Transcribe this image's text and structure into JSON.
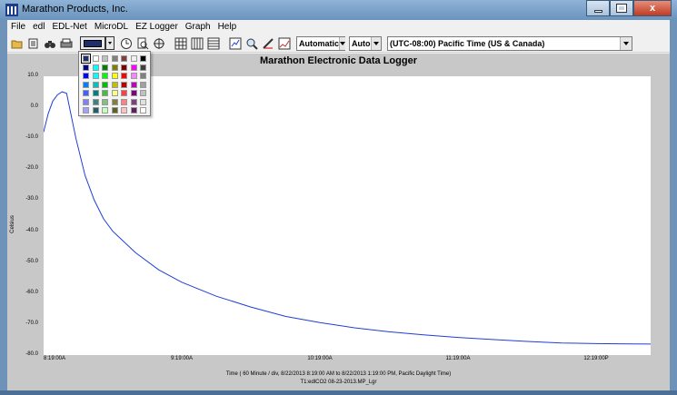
{
  "window": {
    "title": "Marathon Products, Inc.",
    "caption_buttons": {
      "minimize": "minimize",
      "maximize": "maximize",
      "close": "x"
    }
  },
  "menu": [
    "File",
    "edl",
    "EDL-Net",
    "MicroDL",
    "EZ Logger",
    "Graph",
    "Help"
  ],
  "toolbar": {
    "icons": [
      "open-folder-icon",
      "print-preview-icon",
      "binoculars-icon",
      "printer-icon",
      "color-picker-icon",
      "clock-icon",
      "magnify-icon",
      "crosshair-icon",
      "grid-icon",
      "grid-vertical-icon",
      "grid-horizontal-icon",
      "zoom-fit-icon",
      "zoom-icon",
      "ruler-icon",
      "chart-icon"
    ],
    "scale_combo": "Automatic",
    "auto_combo": "Auto",
    "timezone_combo": "(UTC-08:00) Pacific Time (US & Canada)"
  },
  "palette": {
    "colors": [
      [
        "#1f2f6e",
        "#ffffff",
        "#c0c0c0",
        "#808080",
        "#804040",
        "#f0f0f0",
        "#000000"
      ],
      [
        "#000080",
        "#00ffff",
        "#008000",
        "#808000",
        "#800000",
        "#ff00ff",
        "#404040"
      ],
      [
        "#0000ff",
        "#00ffff",
        "#00ff00",
        "#ffff00",
        "#ff0000",
        "#ff80ff",
        "#808080"
      ],
      [
        "#0080ff",
        "#00c0c0",
        "#00c000",
        "#c0c000",
        "#c00000",
        "#c000c0",
        "#a0a0a0"
      ],
      [
        "#4060ff",
        "#008080",
        "#40c040",
        "#ffff80",
        "#ff4040",
        "#800080",
        "#c0c0c0"
      ],
      [
        "#8080ff",
        "#408080",
        "#80c080",
        "#808040",
        "#ff8080",
        "#804080",
        "#e0e0e0"
      ],
      [
        "#a0a0ff",
        "#206060",
        "#c0ffc0",
        "#606020",
        "#ffc0c0",
        "#602060",
        "#ffffff"
      ]
    ],
    "selected": "#1f2f6e"
  },
  "chart_data": {
    "type": "line",
    "title": "Marathon Electronic Data Logger",
    "xlabel": "Time ( 60 Minute / div, 8/22/2013 8:19:00 AM to 8/22/2013 1:19:00 PM, Pacific Daylight Time)",
    "ylabel": "Celsius",
    "file_label": "T1:edlCO2 08-23-2013.MP_Lgr",
    "ylim": [
      -80,
      10
    ],
    "x_tick_labels": [
      "8:19:00A",
      "9:19:00A",
      "10:19:00A",
      "11:19:00A",
      "12:19:00P"
    ],
    "y_tick_labels": [
      "10.0",
      "0.0",
      "-10.0",
      "-20.0",
      "-30.0",
      "-40.0",
      "-50.0",
      "-60.0",
      "-70.0",
      "-80.0"
    ],
    "line_color": "#1f3fd6",
    "series": [
      {
        "x_minutes": [
          0,
          2,
          4,
          6,
          8,
          10,
          14,
          18,
          22,
          26,
          30,
          40,
          50,
          60,
          75,
          90,
          105,
          120,
          135,
          150,
          165,
          180,
          195,
          210,
          225,
          240,
          255,
          270,
          285,
          300
        ],
        "values": [
          -8,
          -2,
          2,
          4,
          5,
          4.5,
          -10,
          -22,
          -30,
          -36,
          -40,
          -47,
          -52.5,
          -56.5,
          -61,
          -64.5,
          -67.5,
          -69.5,
          -71.2,
          -72.5,
          -73.5,
          -74.3,
          -75,
          -75.6,
          -76.1,
          -76.3,
          -76.4,
          -76.5,
          -76.4,
          -76.4
        ]
      }
    ]
  }
}
